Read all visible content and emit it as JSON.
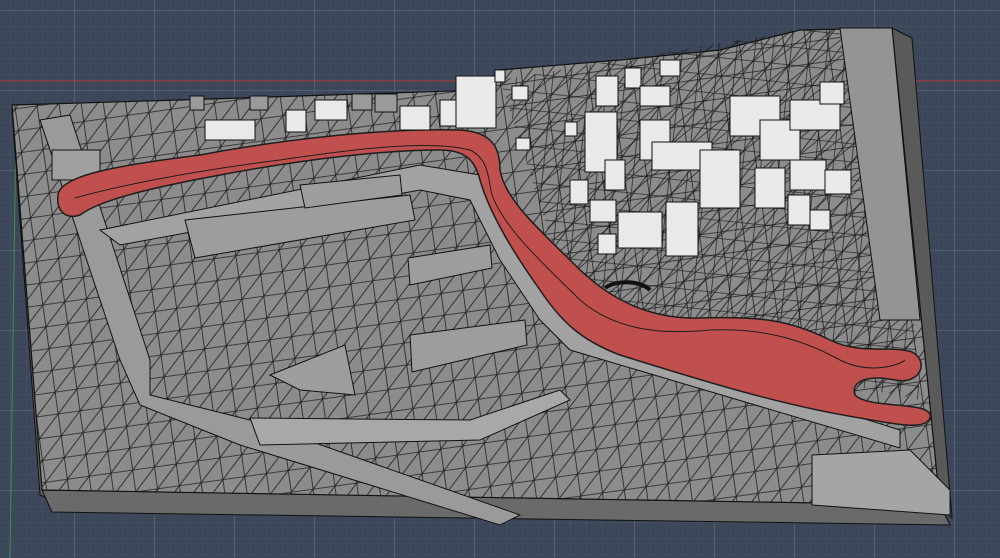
{
  "viewport": {
    "background_color": "#3d475a",
    "grid_color": "#6f7c94",
    "axis_red": "#b83a3a",
    "axis_green": "#3f8f4a"
  },
  "model": {
    "terrain_color": "#8a8a8a",
    "terrain_dark": "#707070",
    "mesh_line_color": "#111111",
    "building_color": "#e8e8e8",
    "walls_color": "#9a9a9a",
    "track_color": "#c0504d",
    "track_edge_color": "#3a1f1f"
  }
}
